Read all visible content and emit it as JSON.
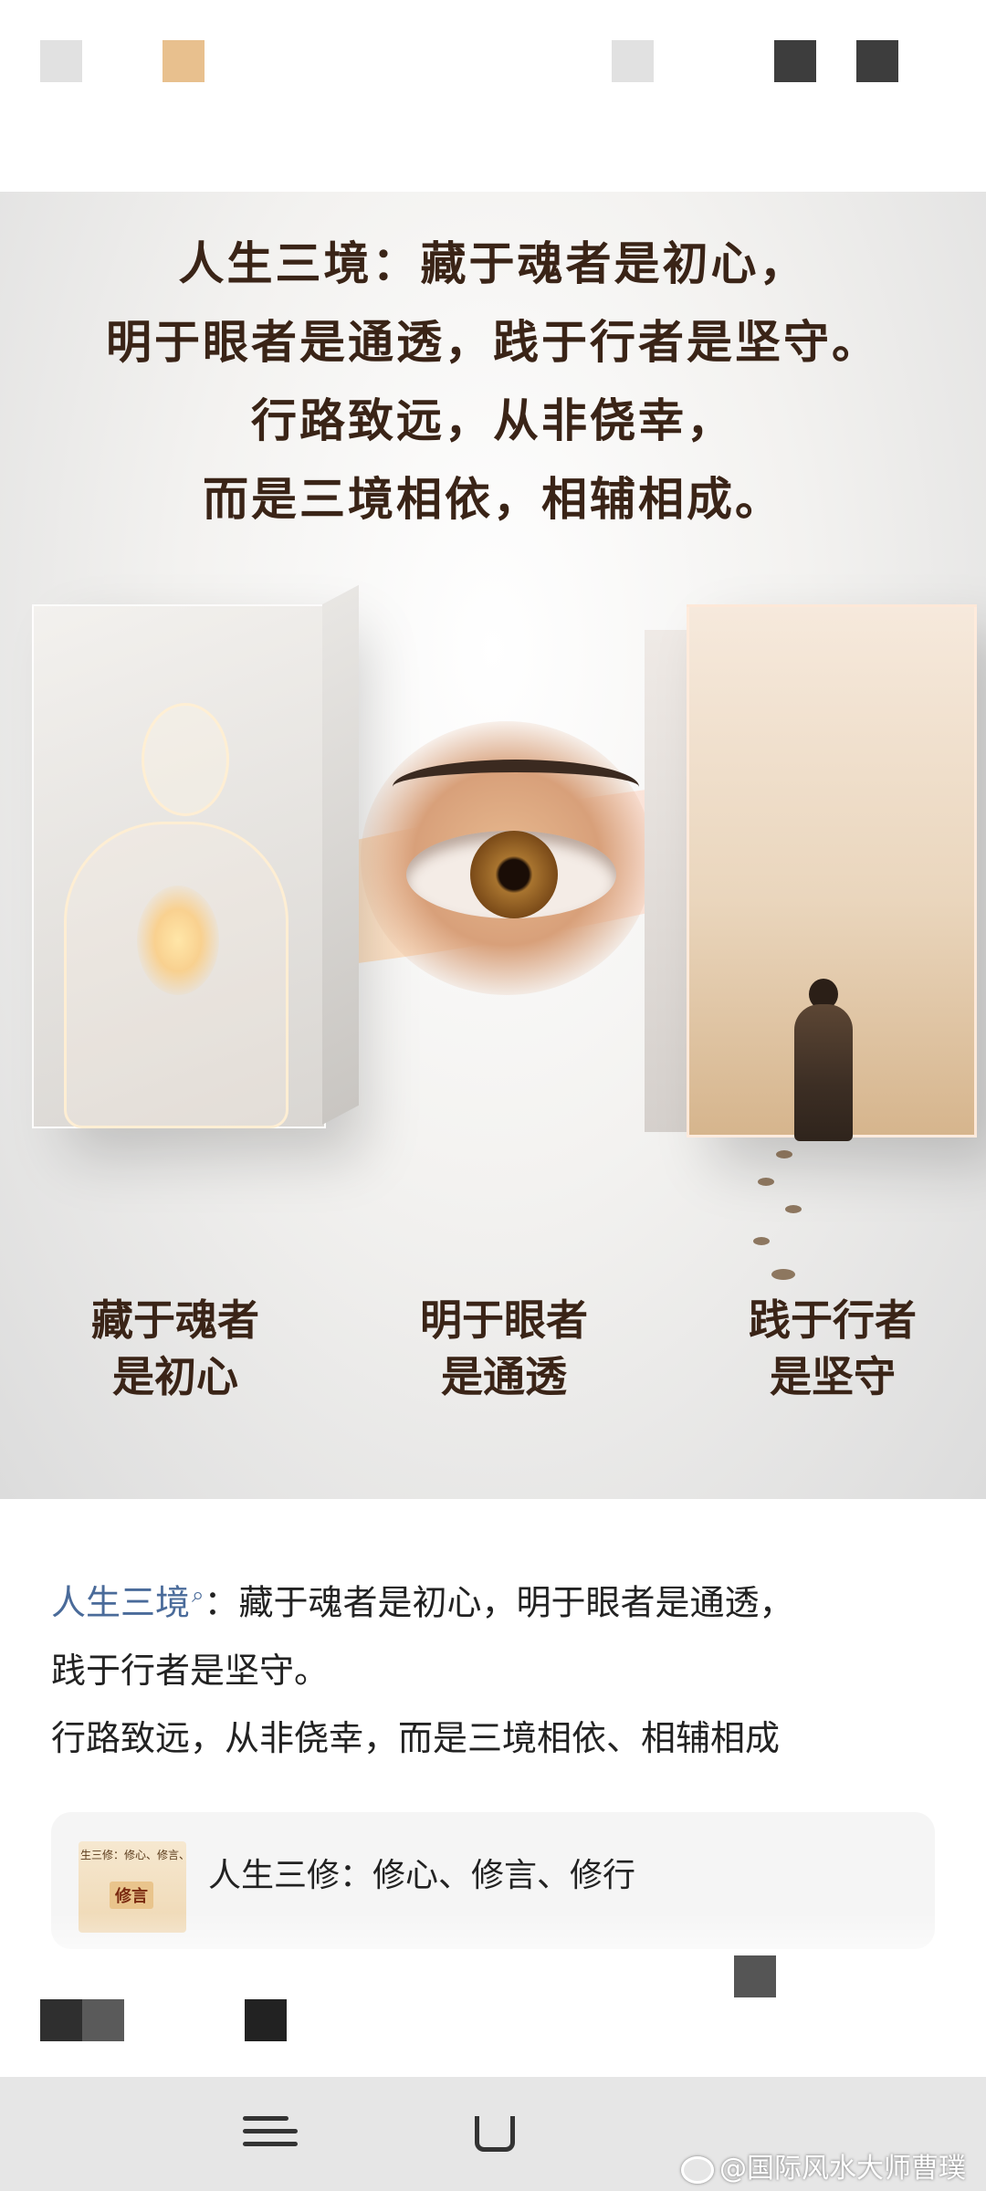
{
  "colors": {
    "link": "#4a6b9a",
    "hero_text": "#3a2417",
    "nav_bar_bg": "#e6e6e6",
    "card_bg": "#f5f5f5"
  },
  "hero": {
    "title_lines": [
      "人生三境：藏于魂者是初心，",
      "明于眼者是通透，践于行者是坚守。",
      "行路致远，从非侥幸，",
      "而是三境相依，相辅相成。"
    ],
    "captions": [
      {
        "line1": "藏于魂者",
        "line2": "是初心"
      },
      {
        "line1": "明于眼者",
        "line2": "是通透"
      },
      {
        "line1": "践于行者",
        "line2": "是坚守"
      }
    ]
  },
  "article": {
    "link_term": "人生三境",
    "link_icon": "search-icon",
    "p1_rest": "：藏于魂者是初心，明于眼者是通透，",
    "p2": "践于行者是坚守。",
    "p3": "行路致远，从非侥幸，而是三境相依、相辅相成"
  },
  "related": {
    "title": "人生三修：修心、修言、修行",
    "thumb_small_text": "生三修：修心、修言、修",
    "thumb_tag": "修言"
  },
  "nav": {
    "menu_icon": "menu-icon",
    "home_icon": "home-icon"
  },
  "watermark": {
    "text": "@国际风水大师曹璞",
    "icon": "weibo-icon"
  }
}
